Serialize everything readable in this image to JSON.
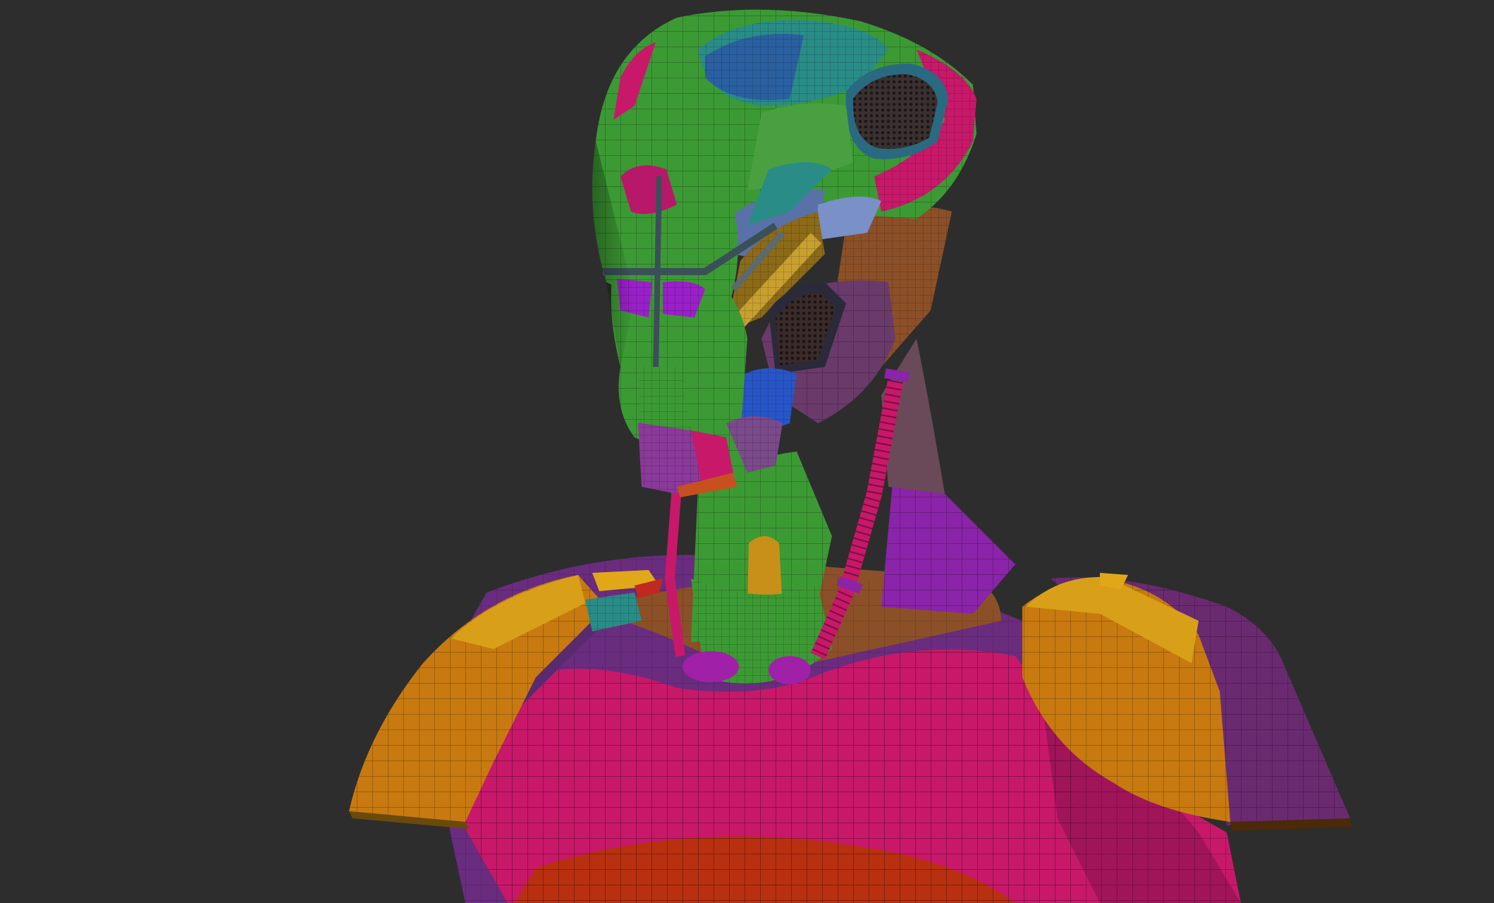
{
  "viewport": {
    "background": "#2d2d2d",
    "subject": "polygroup-colored-robot-bust",
    "display_mode": "polyframe-wireframe-over-polygroups"
  },
  "colors": {
    "skull_green": "#2f8a2c",
    "head_green": "#3c9a34",
    "teal": "#2a8c86",
    "magenta": "#b8185e",
    "pink": "#c8186a",
    "purple": "#8a24a8",
    "violet": "#6a2c8e",
    "orange": "#c87a10",
    "yellow": "#d8a018",
    "blue": "#2856c8",
    "steel_blue": "#5a70a8",
    "red_orange": "#b83010",
    "brown": "#8c5028",
    "dark_violet": "#5a2860"
  }
}
